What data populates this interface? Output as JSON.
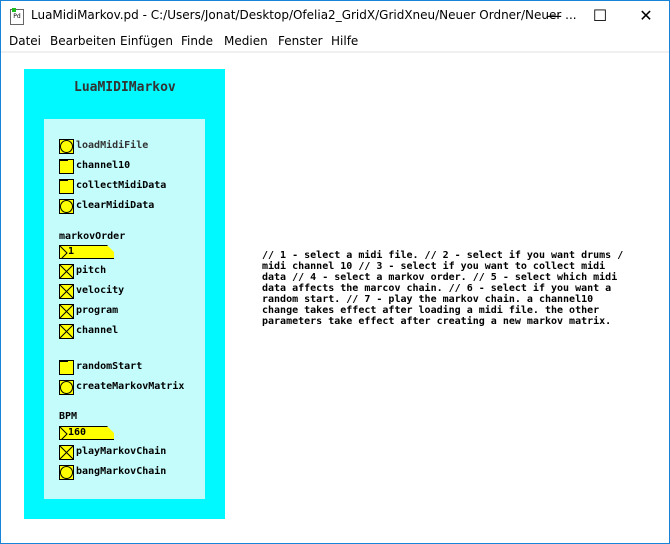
{
  "window": {
    "title": "LuaMidiMarkov.pd  - C:/Users/Jonat/Desktop/Ofelia2_GridX/GridXneu/Neuer Ordner/Neuer ...",
    "icon": "pd-icon",
    "minimize": "—",
    "maximize": "☐",
    "close": "✕"
  },
  "menu": [
    "Datei",
    "Bearbeiten",
    "Einfügen",
    "Finde",
    "Medien",
    "Fenster",
    "Hilfe"
  ],
  "patch": {
    "title": "LuaMIDIMarkov",
    "loadMidiFile": "loadMidiFile",
    "channel10": "channel10",
    "collectMidiData": "collectMidiData",
    "clearMidiData": "clearMidiData",
    "markovOrderLabel": "markovOrder",
    "markovOrder": "1",
    "pitch": "pitch",
    "velocity": "velocity",
    "program": "program",
    "channel": "channel",
    "randomStart": "randomStart",
    "createMarkovMatrix": "createMarkovMatrix",
    "bpmLabel": "BPM",
    "bpm": "160",
    "playMarkovChain": "playMarkovChain",
    "bangMarkovChain": "bangMarkovChain",
    "toggles": {
      "channel10": false,
      "collectMidiData": false,
      "pitch": true,
      "velocity": true,
      "program": true,
      "channel": true,
      "randomStart": false,
      "playMarkovChain": true
    },
    "colors": {
      "outer": "#00f8ff",
      "inner": "#c4fcfc",
      "widget": "#ffff00"
    }
  },
  "comment": "// 1 - select a midi file. // 2 - select if you want drums /\nmidi channel 10 // 3 - select if you want to collect midi\ndata // 4 - select a markov order. // 5 - select which midi\ndata affects the marcov chain. // 6 - select if you want a\nrandom start. // 7 - play the markov chain. a channel10\nchange takes effect after loading a midi file. the other\nparameters take effect after creating a new markov matrix."
}
